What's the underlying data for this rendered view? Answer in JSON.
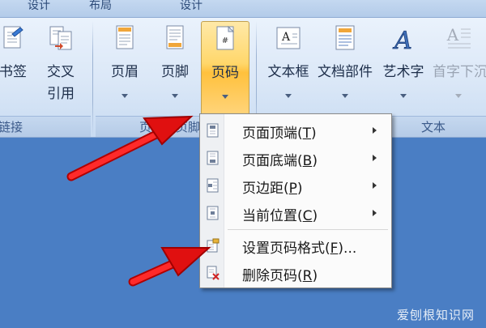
{
  "tabs": [
    "设计",
    "布局",
    "设计"
  ],
  "ribbon": {
    "buttons": [
      {
        "id": "bookmark",
        "label": "书签",
        "icon": "bookmark-icon"
      },
      {
        "id": "cross-ref",
        "label": "交叉",
        "label2": "引用",
        "icon": "cross-reference-icon"
      },
      {
        "id": "header",
        "label": "页眉",
        "icon": "header-icon"
      },
      {
        "id": "footer",
        "label": "页脚",
        "icon": "footer-icon"
      },
      {
        "id": "page-number",
        "label": "页码",
        "icon": "page-number-icon"
      },
      {
        "id": "text-box",
        "label": "文本框",
        "icon": "text-box-icon"
      },
      {
        "id": "quick-parts",
        "label": "文档部件",
        "icon": "quick-parts-icon"
      },
      {
        "id": "wordart",
        "label": "艺术字",
        "icon": "wordart-icon"
      },
      {
        "id": "drop-cap",
        "label": "首字下沉",
        "icon": "drop-cap-icon"
      }
    ],
    "groups": [
      "链接",
      "页眉和页脚",
      "文本"
    ]
  },
  "menu": {
    "items": [
      {
        "label": "页面顶端(",
        "key": "T",
        "tail": ")",
        "submenu": true,
        "icon": "page-top-icon"
      },
      {
        "label": "页面底端(",
        "key": "B",
        "tail": ")",
        "submenu": true,
        "icon": "page-bottom-icon"
      },
      {
        "label": "页边距(",
        "key": "P",
        "tail": ")",
        "submenu": true,
        "icon": "page-margin-icon"
      },
      {
        "label": "当前位置(",
        "key": "C",
        "tail": ")",
        "submenu": true,
        "icon": "current-position-icon"
      },
      {
        "label": "设置页码格式(",
        "key": "F",
        "tail": ")...",
        "submenu": false,
        "icon": "format-page-number-icon"
      },
      {
        "label": "删除页码(",
        "key": "R",
        "tail": ")",
        "submenu": false,
        "icon": "remove-page-number-icon"
      }
    ]
  },
  "watermark": "爱刨根知识网",
  "colors": {
    "document_bg": "#4a7ec4",
    "ribbon_bg": "#dae7f7",
    "active_button": "#ffd76b",
    "annotation_arrow": "#e01010"
  }
}
